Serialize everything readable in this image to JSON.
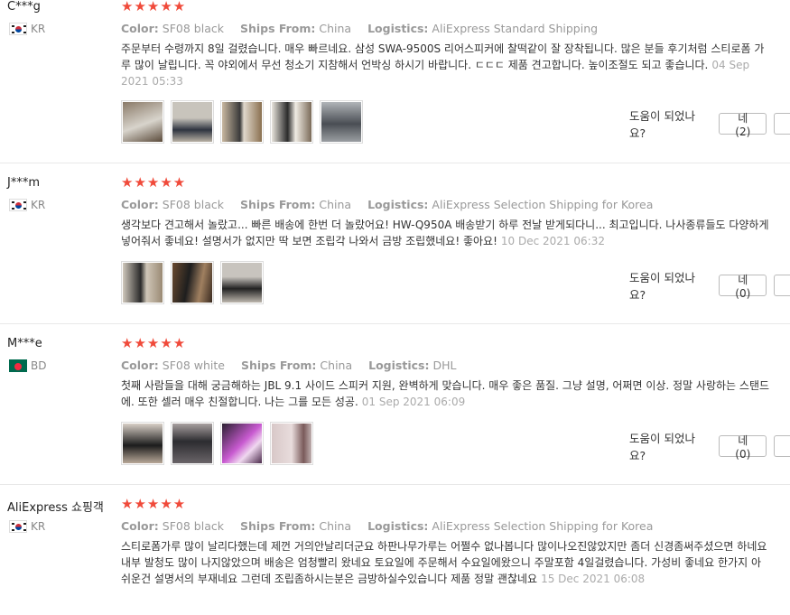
{
  "labels": {
    "color": "Color:",
    "ships": "Ships From:",
    "logistics": "Logistics:",
    "helpful": "도움이 되었나요?"
  },
  "stars": "★★★★★",
  "reviews": [
    {
      "user": "C***g",
      "country": "KR",
      "color": "SF08 black",
      "ships": "China",
      "logistics": "AliExpress Standard Shipping",
      "text": "주문부터 수령까지 8일 걸렸습니다. 매우 빠르네요. 삼성 SWA-9500S 리어스피커에 찰떡같이 잘 장착됩니다. 많은 분들 후기처럼 스티로폼 가루 많이 날립니다. 꼭 야외에서 무선 청소기 지참해서 언박싱 하시기 바랍니다. ㄷㄷㄷ 제품 견고합니다. 높이조절도 되고 좋습니다.",
      "date": "04 Sep 2021 05:33",
      "yes": "네 (2)"
    },
    {
      "user": "J***m",
      "country": "KR",
      "color": "SF08 black",
      "ships": "China",
      "logistics": "AliExpress Selection Shipping for Korea",
      "text": "생각보다 견고해서 놀랐고... 빠른 배송에 한번 더 놀랐어요! HW-Q950A 배송받기 하루 전날 받게되다니... 최고입니다. 나사종류들도 다양하게 넣어줘서 좋네요! 설명서가 없지만 딱 보면 조립각 나와서 금방 조립했네요! 좋아요!",
      "date": "10 Dec 2021 06:32",
      "yes": "네 (0)"
    },
    {
      "user": "M***e",
      "country": "BD",
      "color": "SF08 white",
      "ships": "China",
      "logistics": "DHL",
      "text": "첫째 사람들을 대해 궁금해하는 JBL 9.1 사이드 스피커 지원, 완벽하게 맞습니다. 매우 좋은 품질. 그냥 설명, 어쩌면 이상. 정말 사랑하는 스탠드에. 또한 셀러 매우 친절합니다. 나는 그를 모든 성공.",
      "date": "01 Sep 2021 06:09",
      "yes": "네 (0)"
    },
    {
      "user": "AliExpress 쇼핑객",
      "country": "KR",
      "color": "SF08 black",
      "ships": "China",
      "logistics": "AliExpress Selection Shipping for Korea",
      "text": "스티로폼가루 많이 날리다했는데 제껀 거의안날리더군요 하판나무가루는 어쩔수 없나봅니다 많이나오진않았지만 좀더 신경좀써주셨으면 하네요 내부 발청도 많이 나지않았으며 배송은 엄청빨리 왔네요 토요일에 주문해서 수요일에왔으니 주말포함 4일걸렸습니다. 가성비 좋네요 한가지 아쉬운건 설명서의 부재네요 그런데 조립좀하시는분은 금방하실수있습니다 제품 정말 괜찮네요",
      "date": "15 Dec 2021 06:08",
      "yes": ""
    }
  ]
}
